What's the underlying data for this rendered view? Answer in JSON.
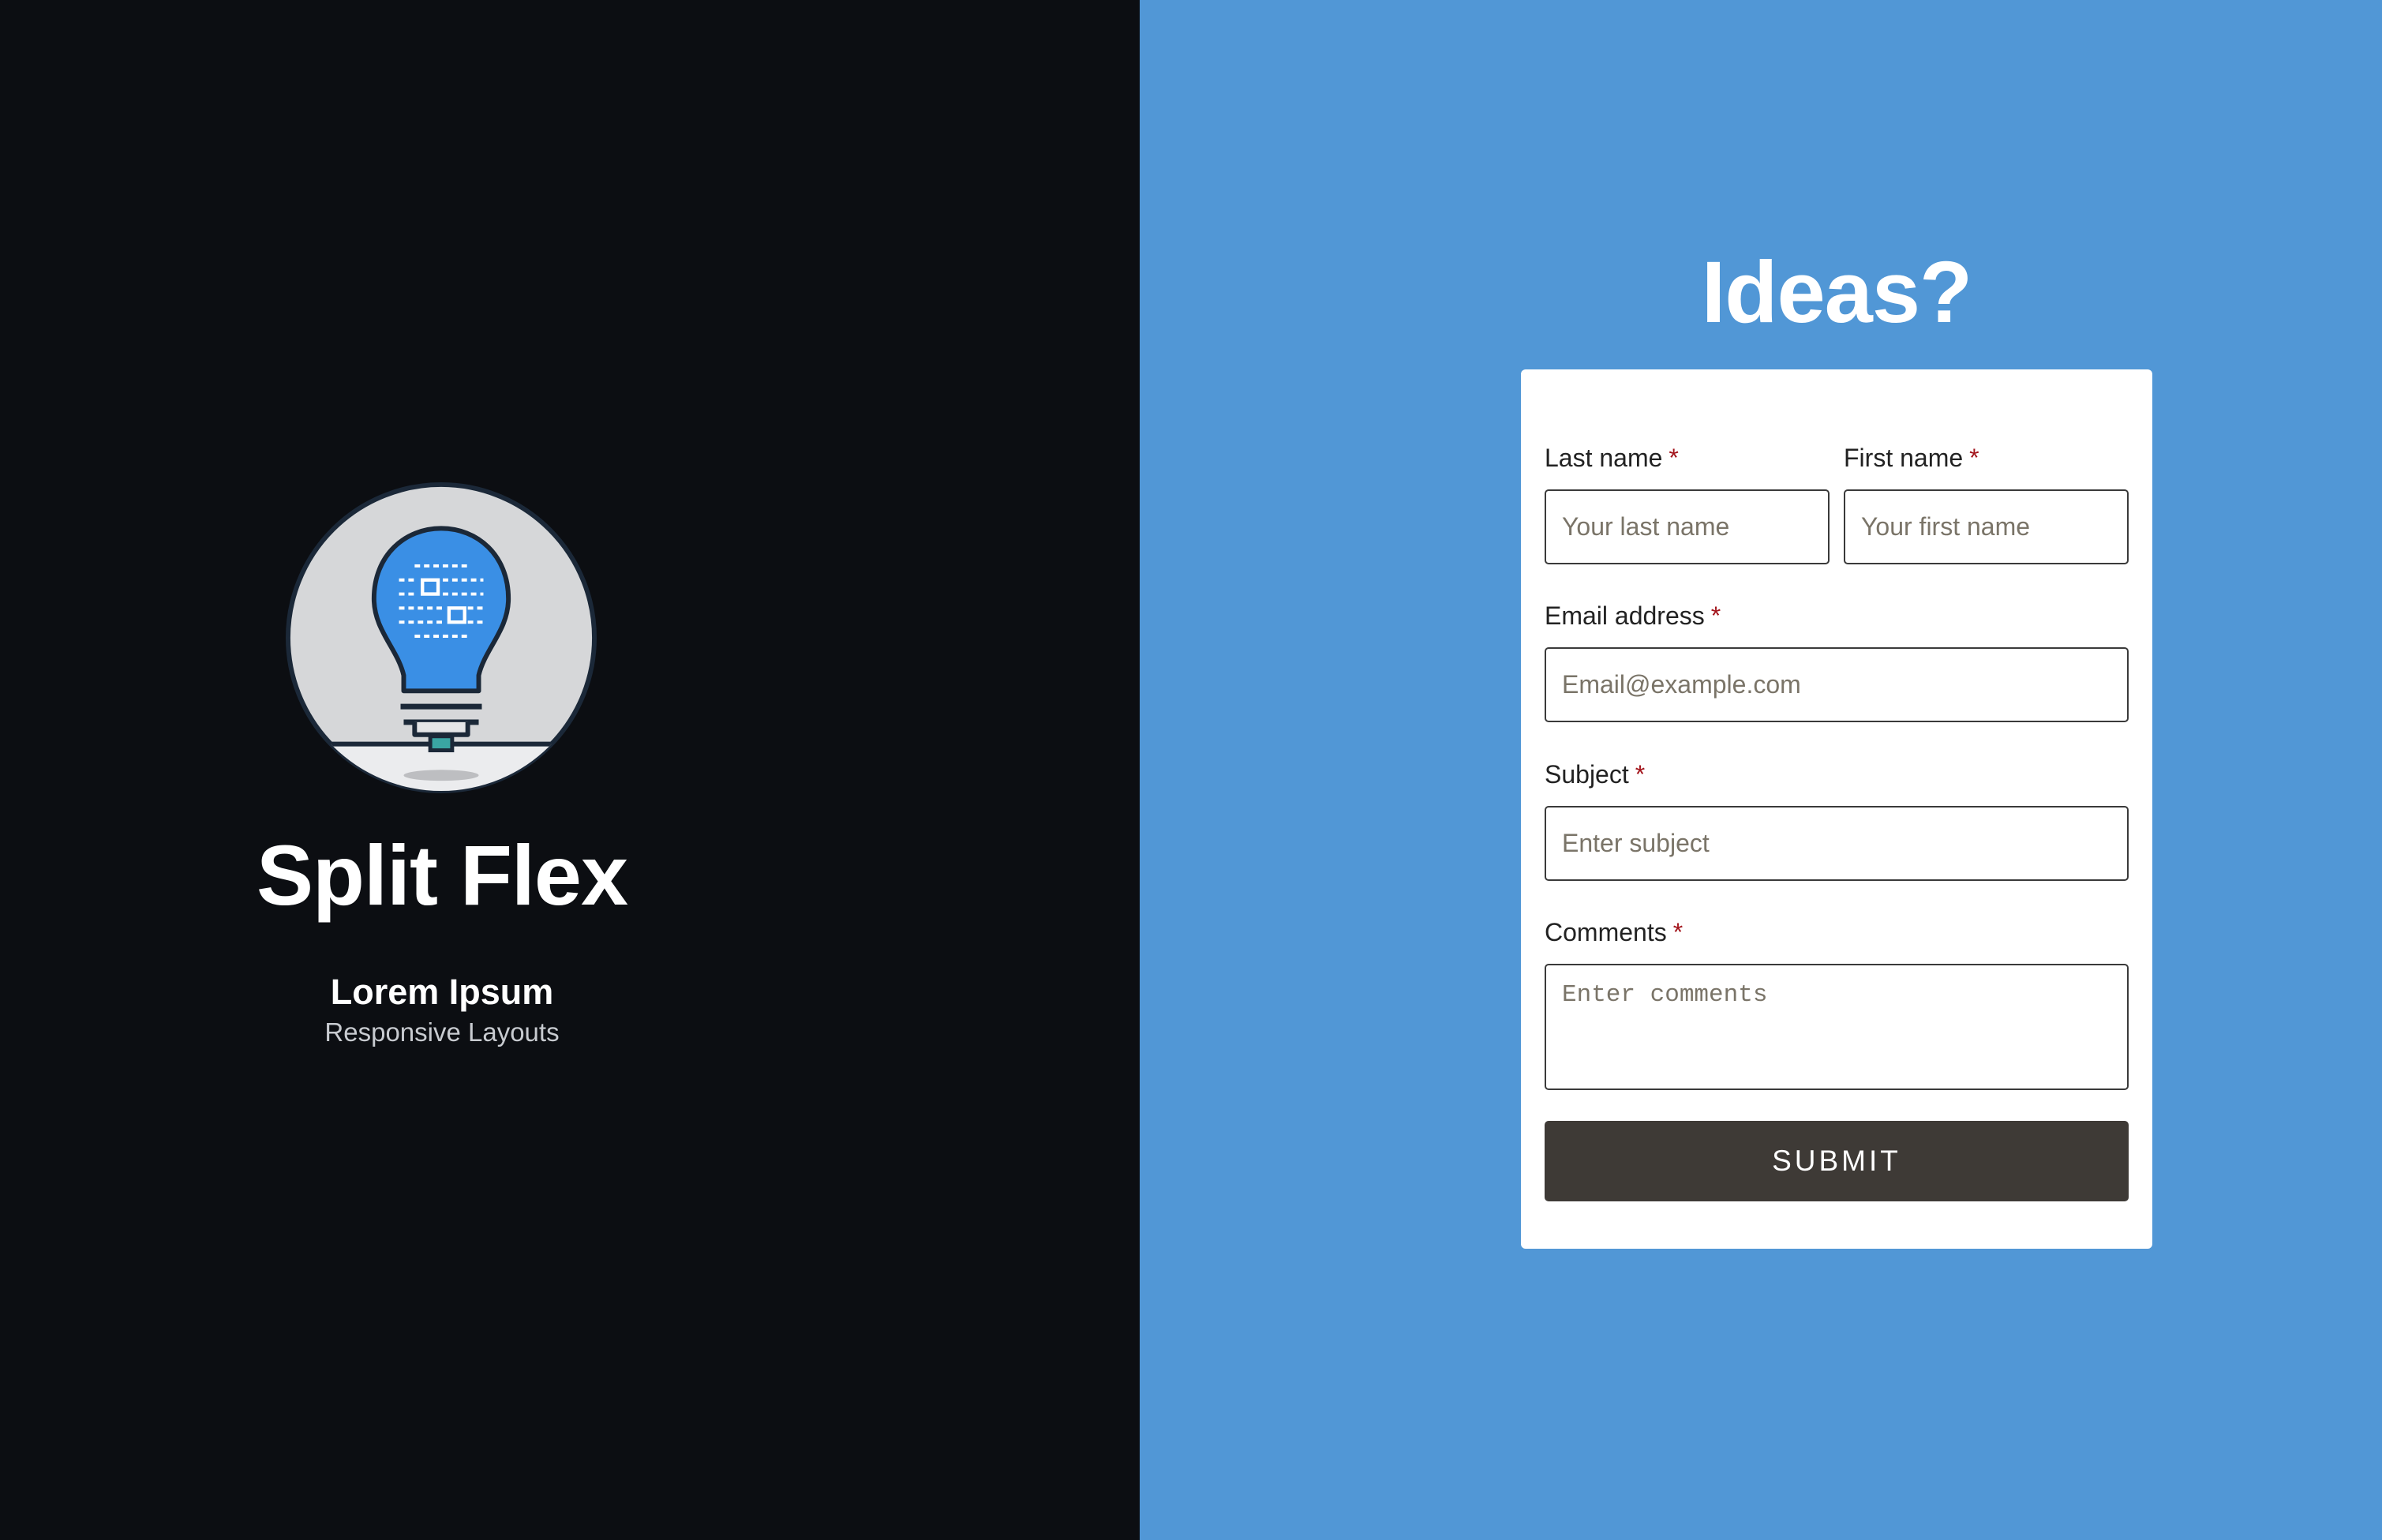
{
  "brand": {
    "title": "Split Flex",
    "subtitle": "Lorem Ipsum",
    "tagline": "Responsive Layouts",
    "logo_icon": "lightbulb-icon"
  },
  "form": {
    "heading": "Ideas?",
    "required_marker": "*",
    "last_name": {
      "label": "Last name",
      "placeholder": "Your last name",
      "value": ""
    },
    "first_name": {
      "label": "First name",
      "placeholder": "Your first name",
      "value": ""
    },
    "email": {
      "label": "Email address",
      "placeholder": "Email@example.com",
      "value": ""
    },
    "subject": {
      "label": "Subject",
      "placeholder": "Enter subject",
      "value": ""
    },
    "comments": {
      "label": "Comments",
      "placeholder": "Enter comments",
      "value": ""
    },
    "submit_label": "SUBMIT"
  },
  "colors": {
    "left_background": "#0c0e12",
    "right_background": "#5197d6",
    "card_background": "#ffffff",
    "submit_background": "#3e3a36",
    "required_marker": "#a3151c",
    "bulb_blue": "#3a8fe5",
    "badge_gray": "#d6d7d9"
  }
}
